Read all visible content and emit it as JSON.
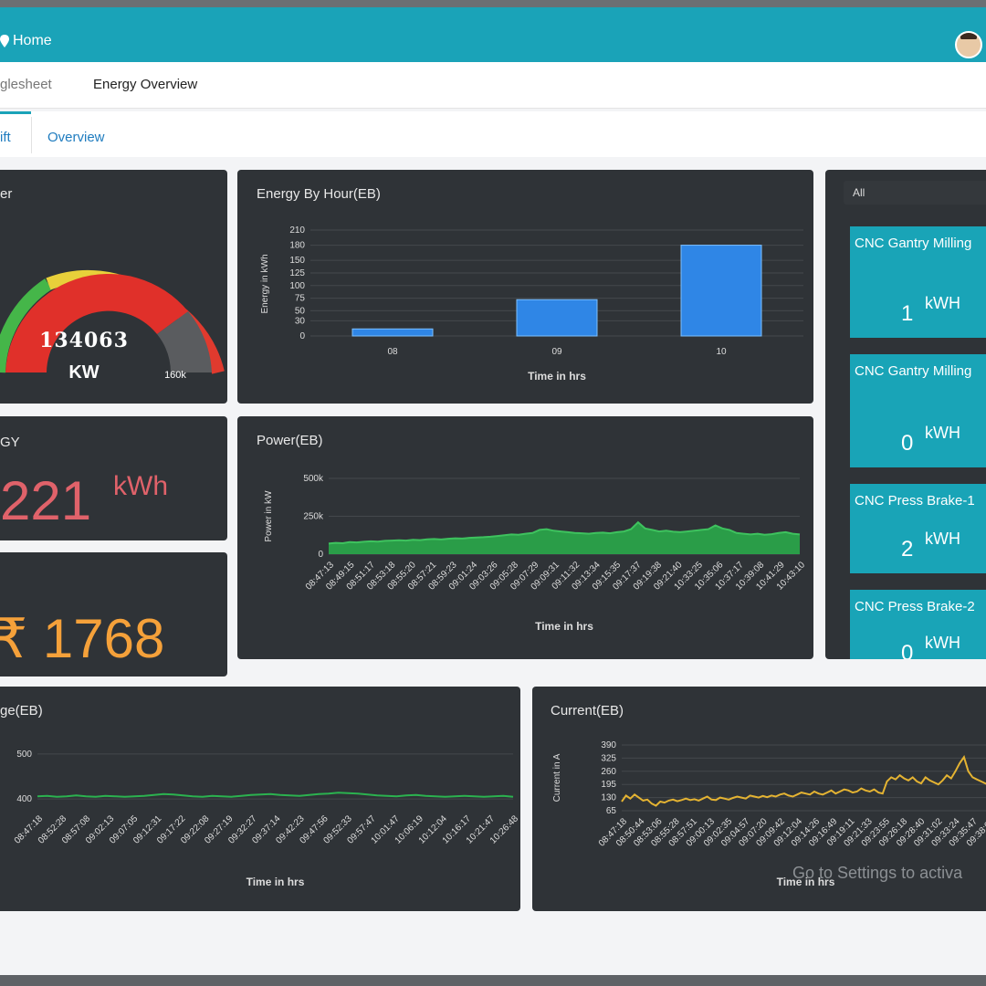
{
  "topbar": {
    "home_label": "Home"
  },
  "subnav": {
    "item_1": "glesheet",
    "item_2": "Energy Overview"
  },
  "tabs": {
    "active": "ift",
    "overview": "Overview"
  },
  "gauge_panel": {
    "title": "er",
    "value": "134063",
    "unit": "KW",
    "max_label": "160k"
  },
  "energy_panel": {
    "title": "GY",
    "value": "221",
    "unit": "kWh"
  },
  "cost_panel": {
    "title": "",
    "value": "₹ 1768"
  },
  "machines_panel": {
    "dropdown": "All",
    "items": [
      {
        "name": "CNC Gantry Milling",
        "value": "1",
        "unit": "kWH"
      },
      {
        "name": "CNC Gantry Milling",
        "value": "0",
        "unit": "kWH"
      },
      {
        "name": "CNC Press Brake-1",
        "value": "2",
        "unit": "kWH"
      },
      {
        "name": "CNC Press Brake-2",
        "value": "0",
        "unit": "kWH"
      }
    ]
  },
  "watermark": "Go to Settings to activa",
  "charts": {
    "energy_by_hour": {
      "title": "Energy By Hour(EB)",
      "xlabel": "Time in hrs",
      "ylabel": "Energy in kWh",
      "yticks": [
        "0",
        "30",
        "50",
        "75",
        "100",
        "125",
        "150",
        "180",
        "210"
      ],
      "xticks": [
        "08",
        "09",
        "10"
      ]
    },
    "power": {
      "title": "Power(EB)",
      "xlabel": "Time in hrs",
      "ylabel": "Power in kW",
      "yticks": [
        "0",
        "250k",
        "500k"
      ],
      "xticks": [
        "08:47:13",
        "08:49:15",
        "08:51:17",
        "08:53:18",
        "08:55:20",
        "08:57:21",
        "08:59:23",
        "09:01:24",
        "09:03:26",
        "09:05:28",
        "09:07:29",
        "09:09:31",
        "09:11:32",
        "09:13:34",
        "09:15:35",
        "09:17:37",
        "09:19:38",
        "09:21:40",
        "10:33:25",
        "10:35:06",
        "10:37:17",
        "10:39:08",
        "10:41:29",
        "10:43:10"
      ]
    },
    "voltage": {
      "title": "ge(EB)",
      "xlabel": "Time in hrs",
      "yticks": [
        "400",
        "500"
      ],
      "xticks": [
        "08:47:18",
        "08:52:28",
        "08:57:08",
        "09:02:13",
        "09:07:05",
        "09:12:31",
        "09:17:22",
        "09:22:08",
        "09:27:19",
        "09:32:27",
        "09:37:14",
        "09:42:23",
        "09:47:56",
        "09:52:33",
        "09:57:47",
        "10:01:47",
        "10:06:19",
        "10:12:04",
        "10:16:17",
        "10:21:47",
        "10:26:48"
      ]
    },
    "current": {
      "title": "Current(EB)",
      "xlabel": "Time in hrs",
      "ylabel": "Current in A",
      "yticks": [
        "65",
        "130",
        "195",
        "260",
        "325",
        "390"
      ],
      "xticks": [
        "08:47:18",
        "08:50:44",
        "08:53:06",
        "08:55:28",
        "08:57:51",
        "09:00:13",
        "09:02:35",
        "09:04:57",
        "09:07:20",
        "09:09:42",
        "09:12:04",
        "09:14:26",
        "09:16:49",
        "09:19:11",
        "09:21:33",
        "09:23:55",
        "09:26:18",
        "09:28:40",
        "09:31:02",
        "09:33:24",
        "09:35:47",
        "09:38:09"
      ]
    }
  },
  "chart_data": [
    {
      "type": "bar",
      "title": "Energy By Hour(EB)",
      "xlabel": "Time in hrs",
      "ylabel": "Energy in kWh",
      "categories": [
        "08",
        "09",
        "10"
      ],
      "values": [
        14,
        72,
        180
      ],
      "ylim": [
        0,
        210
      ],
      "grid": true
    },
    {
      "type": "area",
      "title": "Power(EB)",
      "xlabel": "Time in hrs",
      "ylabel": "Power in kW",
      "ylim": [
        0,
        500000
      ],
      "grid": true,
      "values": [
        70000,
        75000,
        72000,
        80000,
        78000,
        82000,
        85000,
        83000,
        88000,
        90000,
        92000,
        90000,
        95000,
        93000,
        98000,
        100000,
        97000,
        102000,
        105000,
        103000,
        108000,
        110000,
        112000,
        115000,
        120000,
        125000,
        130000,
        128000,
        135000,
        140000,
        160000,
        165000,
        155000,
        150000,
        145000,
        140000,
        138000,
        135000,
        140000,
        142000,
        138000,
        145000,
        150000,
        165000,
        210000,
        170000,
        160000,
        150000,
        155000,
        148000,
        145000,
        150000,
        155000,
        160000,
        165000,
        190000,
        170000,
        160000,
        140000,
        135000,
        130000,
        135000,
        128000,
        132000,
        140000,
        145000,
        135000,
        130000
      ]
    },
    {
      "type": "line",
      "title": "ge(EB)",
      "xlabel": "Time in hrs",
      "ylim": [
        380,
        520
      ],
      "grid": true,
      "values": [
        406,
        407,
        405,
        406,
        408,
        406,
        405,
        407,
        406,
        405,
        406,
        407,
        409,
        411,
        410,
        408,
        406,
        405,
        407,
        406,
        405,
        407,
        409,
        410,
        411,
        409,
        408,
        407,
        409,
        411,
        412,
        414,
        413,
        412,
        410,
        408,
        407,
        406,
        408,
        409,
        407,
        406,
        405,
        406,
        407,
        406,
        405,
        406,
        407,
        405
      ]
    },
    {
      "type": "line",
      "title": "Current(EB)",
      "xlabel": "Time in hrs",
      "ylabel": "Current in A",
      "ylim": [
        65,
        390
      ],
      "grid": true,
      "values": [
        110,
        140,
        125,
        145,
        130,
        115,
        120,
        100,
        90,
        110,
        105,
        115,
        120,
        112,
        118,
        125,
        118,
        122,
        115,
        125,
        135,
        120,
        118,
        130,
        125,
        120,
        128,
        135,
        130,
        125,
        140,
        135,
        130,
        138,
        132,
        140,
        135,
        145,
        150,
        140,
        135,
        145,
        155,
        150,
        145,
        160,
        150,
        145,
        155,
        165,
        150,
        160,
        170,
        165,
        155,
        160,
        175,
        165,
        160,
        170,
        155,
        150,
        210,
        230,
        220,
        240,
        225,
        215,
        230,
        210,
        200,
        230,
        215,
        205,
        195,
        215,
        240,
        225,
        260,
        300,
        330,
        260,
        230,
        220,
        210,
        200,
        190
      ]
    }
  ]
}
